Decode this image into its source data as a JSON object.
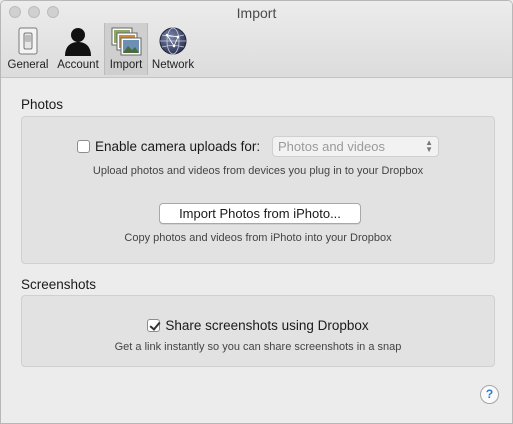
{
  "window": {
    "title": "Import"
  },
  "toolbar": {
    "items": [
      {
        "label": "General",
        "icon": "toggle-switch-icon"
      },
      {
        "label": "Account",
        "icon": "person-icon"
      },
      {
        "label": "Import",
        "icon": "photos-stack-icon",
        "active": true
      },
      {
        "label": "Network",
        "icon": "globe-icon"
      }
    ]
  },
  "photos": {
    "heading": "Photos",
    "camera_uploads": {
      "label": "Enable camera uploads for:",
      "checked": false,
      "select_value": "Photos and videos",
      "description": "Upload photos and videos from devices you plug in to your Dropbox"
    },
    "import_button": {
      "label": "Import Photos from iPhoto...",
      "description": "Copy photos and videos from iPhoto into your Dropbox"
    }
  },
  "screenshots": {
    "heading": "Screenshots",
    "share": {
      "label": "Share screenshots using Dropbox",
      "checked": true,
      "description": "Get a link instantly so you can share screenshots in a snap"
    }
  },
  "help": {
    "label": "?"
  }
}
